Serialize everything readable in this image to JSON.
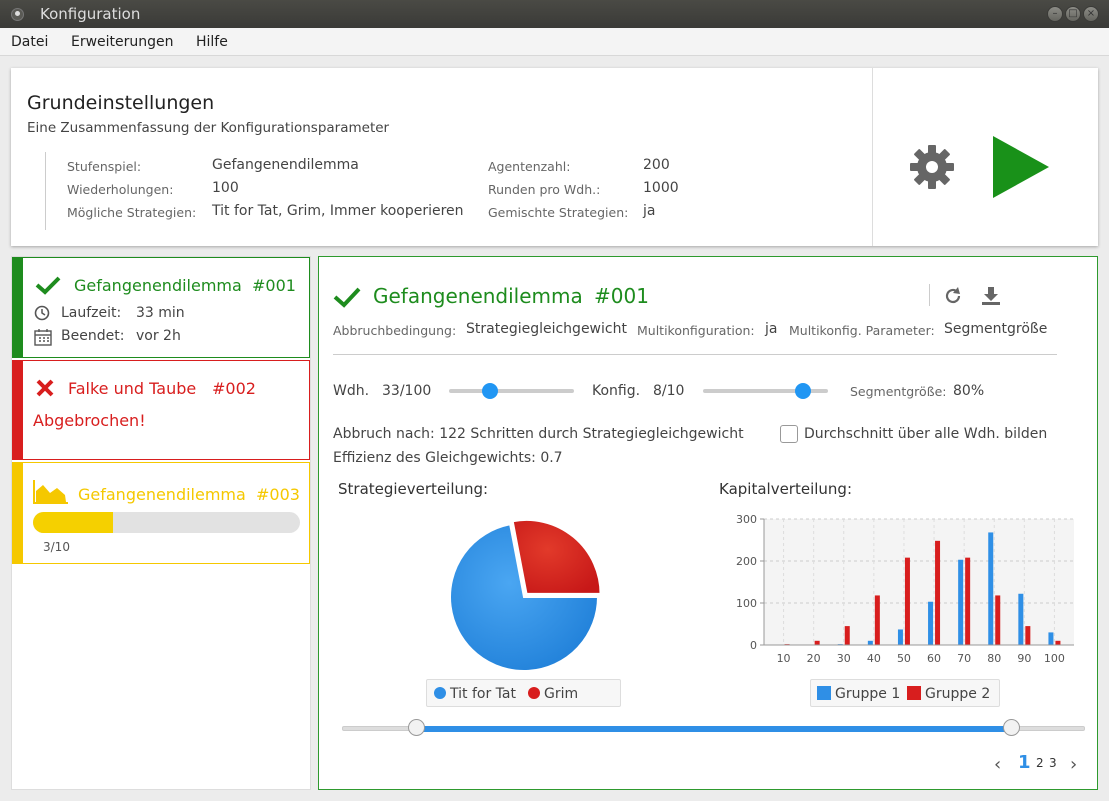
{
  "window": {
    "title": "Konfiguration"
  },
  "menu": {
    "items": [
      "Datei",
      "Erweiterungen",
      "Hilfe"
    ]
  },
  "summary": {
    "title": "Grundeinstellungen",
    "subtitle": "Eine Zusammenfassung der Konfigurationsparameter",
    "params": [
      {
        "label": "Stufenspiel:",
        "value": "Gefangenendilemma"
      },
      {
        "label": "Wiederholungen:",
        "value": "100"
      },
      {
        "label": "Mögliche Strategien:",
        "value": "Tit for Tat, Grim, Immer kooperieren"
      },
      {
        "label": "Agentenzahl:",
        "value": "200"
      },
      {
        "label": "Runden pro Wdh.:",
        "value": "1000"
      },
      {
        "label": "Gemischte Strategien:",
        "value": "ja"
      }
    ]
  },
  "runs": [
    {
      "name": "Gefangenendilemma",
      "id": "#001",
      "status": "done",
      "runtime_label": "Laufzeit:",
      "runtime": "33 min",
      "finished_label": "Beendet:",
      "finished": "vor 2h",
      "color": "#1e8c1e"
    },
    {
      "name": "Falke und Taube",
      "id": "#002",
      "status": "aborted",
      "message": "Abgebrochen!",
      "color": "#d81e1e"
    },
    {
      "name": "Gefangenendilemma",
      "id": "#003",
      "status": "running",
      "progress": 0.3,
      "progress_text": "3/10",
      "color": "#f5c800"
    }
  ],
  "detail": {
    "title": "Gefangenendilemma",
    "id": "#001",
    "abbruch_label": "Abbruchbedingung:",
    "abbruch_value": "Strategiegleichgewicht",
    "multi_label": "Multikonfiguration:",
    "multi_value": "ja",
    "multi_param_label": "Multikonfig. Parameter:",
    "multi_param_value": "Segmentgröße",
    "wdh_label": "Wdh.",
    "wdh_value": "33/100",
    "wdh_fraction": 0.33,
    "konfig_label": "Konfig.",
    "konfig_value": "8/10",
    "konfig_fraction": 0.8,
    "segment_label": "Segmentgröße:",
    "segment_value": "80%",
    "abbruch_text": "Abbruch nach: 122 Schritten durch Strategiegleichgewicht",
    "avg_checkbox": "Durchschnitt über alle Wdh. bilden",
    "avg_checked": false,
    "effizienz": "Effizienz des Gleichgewichts: 0.7",
    "range_low": 0.1,
    "range_high": 0.9,
    "pagination": {
      "pages": [
        "1",
        "2",
        "3"
      ],
      "current": "1"
    }
  },
  "chart_data": [
    {
      "type": "pie",
      "title": "Strategieverteilung:",
      "labels": [
        "Tit for Tat",
        "Grim"
      ],
      "values": [
        72,
        28
      ],
      "colors": [
        "#2f8fe6",
        "#d81e1e"
      ]
    },
    {
      "type": "bar",
      "title": "Kapitalverteilung:",
      "categories": [
        "10",
        "20",
        "30",
        "40",
        "50",
        "60",
        "70",
        "80",
        "90",
        "100"
      ],
      "series": [
        {
          "name": "Gruppe 1",
          "values": [
            0,
            0,
            2,
            10,
            37,
            103,
            203,
            268,
            122,
            30
          ],
          "color": "#2f8fe6"
        },
        {
          "name": "Gruppe 2",
          "values": [
            2,
            10,
            45,
            118,
            208,
            248,
            208,
            118,
            45,
            10
          ],
          "color": "#d81e1e"
        }
      ],
      "ylim": [
        0,
        300
      ],
      "yticks": [
        0,
        100,
        200,
        300
      ],
      "grid": true,
      "legend": "bottom"
    }
  ]
}
